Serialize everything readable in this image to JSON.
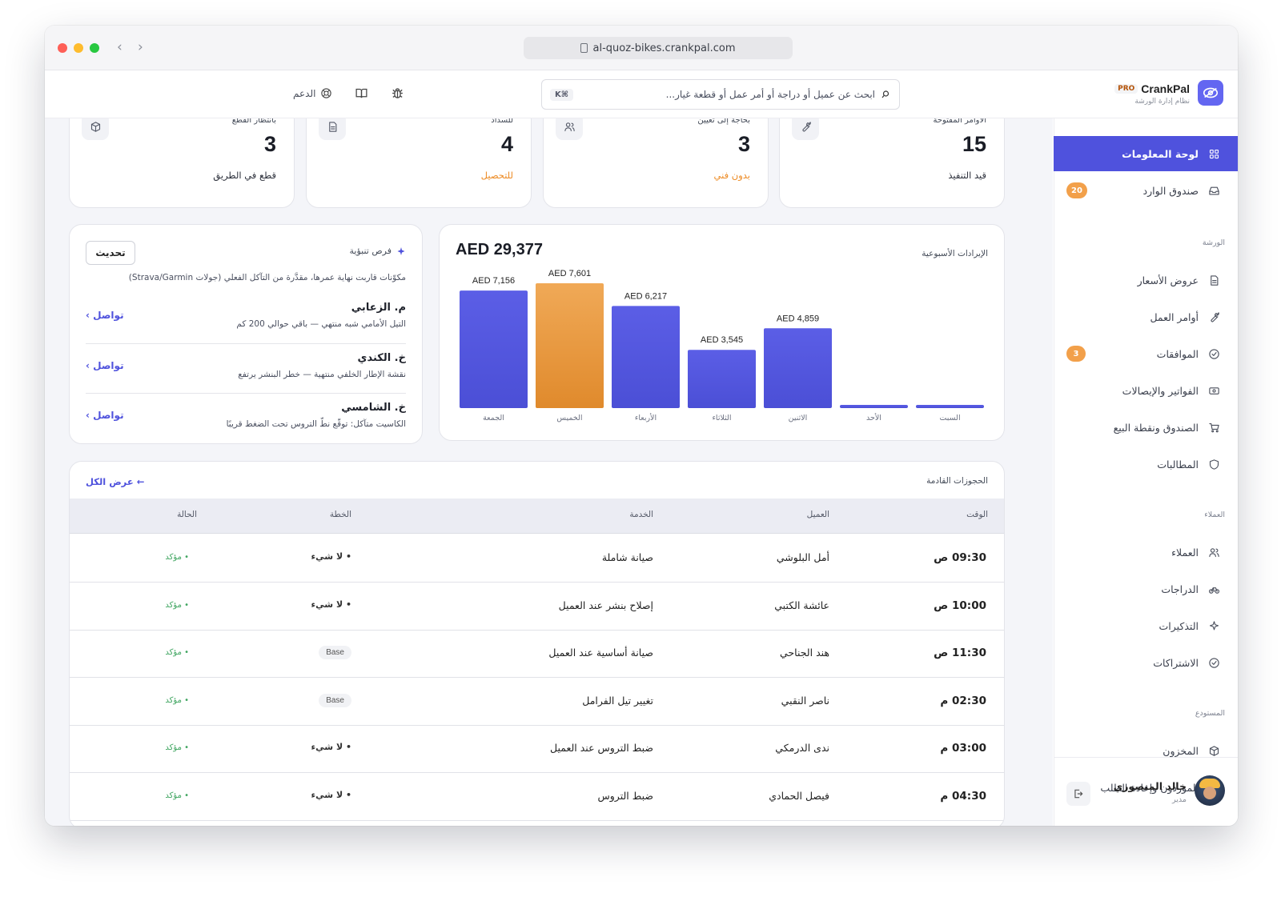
{
  "browser": {
    "url": "al-quoz-bikes.crankpal.com"
  },
  "app": {
    "name": "CrankPal",
    "plan_badge": "PRO",
    "subtitle": "نظام إدارة الورشة"
  },
  "search": {
    "placeholder": "ابحث عن عميل أو دراجة أو أمر عمل أو قطعة غيار...",
    "shortcut": "⌘K"
  },
  "topbar": {
    "support": "الدعم",
    "icons": [
      "bug-icon",
      "book-icon",
      "lifebuoy-icon"
    ]
  },
  "sidebar": {
    "items": [
      {
        "label": "لوحة المعلومات",
        "icon": "dashboard-icon",
        "active": true
      },
      {
        "label": "صندوق الوارد",
        "icon": "inbox-icon",
        "badge": "20"
      }
    ],
    "sections": [
      {
        "title": "الورشة",
        "items": [
          {
            "label": "عروض الأسعار",
            "icon": "quote-icon"
          },
          {
            "label": "أوامر العمل",
            "icon": "wrench-icon"
          },
          {
            "label": "الموافقات",
            "icon": "check-circle-icon",
            "badge": "3"
          },
          {
            "label": "الفواتير والإيصالات",
            "icon": "cash-icon"
          },
          {
            "label": "الصندوق ونقطة البيع",
            "icon": "cart-icon"
          },
          {
            "label": "المطالبات",
            "icon": "shield-icon"
          }
        ]
      },
      {
        "title": "العملاء",
        "items": [
          {
            "label": "العملاء",
            "icon": "users-icon"
          },
          {
            "label": "الدراجات",
            "icon": "bike-icon"
          },
          {
            "label": "التذكيرات",
            "icon": "sparkle-icon"
          },
          {
            "label": "الاشتراكات",
            "icon": "check-circle-icon"
          }
        ]
      },
      {
        "title": "المستودع",
        "items": [
          {
            "label": "المخزون",
            "icon": "box-icon"
          },
          {
            "label": "الموردون وإعادة الطلب",
            "icon": "truck-icon"
          }
        ]
      }
    ],
    "user": {
      "name": "خالد المنصوري",
      "role": "مدير"
    }
  },
  "stats": [
    {
      "label": "الأوامر المفتوحة",
      "value": "15",
      "sub": "قيد التنفيذ",
      "icon": "wrench-icon"
    },
    {
      "label": "بحاجة إلى تعيين",
      "value": "3",
      "sub": "بدون فني",
      "icon": "users-icon"
    },
    {
      "label": "للسداد",
      "value": "4",
      "sub": "للتحصيل",
      "icon": "document-icon"
    },
    {
      "label": "بانتظار القطع",
      "value": "3",
      "sub": "قطع في الطريق",
      "icon": "box-icon"
    }
  ],
  "revenue": {
    "title": "الإيرادات الأسبوعية",
    "total": "AED 29,377"
  },
  "chart_data": {
    "type": "bar",
    "title": "الإيرادات الأسبوعية",
    "categories": [
      "الجمعة",
      "الخميس",
      "الأربعاء",
      "الثلاثاء",
      "الاثنين",
      "الأحد",
      "السبت"
    ],
    "values": [
      7156,
      7601,
      6217,
      3545,
      4859,
      0,
      0
    ],
    "data_labels": [
      "AED 7,156",
      "AED 7,601",
      "AED 6,217",
      "AED 3,545",
      "AED 4,859",
      "",
      ""
    ],
    "highlight_index": 1,
    "colors": {
      "bar": "#5457e0",
      "highlight": "#ec9a3f"
    },
    "grid": false
  },
  "insights": {
    "title": "فرص تنبؤية",
    "refresh": "تحديث",
    "description": "مكوّنات قاربت نهاية عمرها، مقدَّرة من التآكل الفعلي (جولات Strava/Garmin)",
    "items": [
      {
        "name": "م. الزعابي",
        "detail": "التيل الأمامي شبه منتهي — باقي حوالي 200 كم",
        "cta": "تواصل ›"
      },
      {
        "name": "خ. الكندي",
        "detail": "نقشة الإطار الخلفي منتهية — خطر البنشر يرتفع",
        "cta": "تواصل ›"
      },
      {
        "name": "خ. الشامسي",
        "detail": "الكاسيت متآكل: توقّع نطّ التروس تحت الضغط قريبًا",
        "cta": "تواصل ›"
      }
    ]
  },
  "bookings": {
    "title": "الحجوزات القادمة",
    "view_all": "عرض الكل ←",
    "columns": {
      "time": "الوقت",
      "customer": "العميل",
      "service": "الخدمة",
      "plan": "الخطة",
      "status": "الحالة"
    },
    "rows": [
      {
        "time": "09:30 ص",
        "customer": "أمل البلوشي",
        "service": "صيانة شاملة",
        "plan": "• لا شيء",
        "plan_pill": false,
        "status": "• مؤكد"
      },
      {
        "time": "10:00 ص",
        "customer": "عائشة الكتبي",
        "service": "إصلاح بنشر عند العميل",
        "plan": "• لا شيء",
        "plan_pill": false,
        "status": "• مؤكد"
      },
      {
        "time": "11:30 ص",
        "customer": "هند الجناحي",
        "service": "صيانة أساسية عند العميل",
        "plan": "Base",
        "plan_pill": true,
        "status": "• مؤكد"
      },
      {
        "time": "02:30 م",
        "customer": "ناصر النقبي",
        "service": "تغيير تيل الفرامل",
        "plan": "Base",
        "plan_pill": true,
        "status": "• مؤكد"
      },
      {
        "time": "03:00 م",
        "customer": "ندى الدرمكي",
        "service": "ضبط التروس عند العميل",
        "plan": "• لا شيء",
        "plan_pill": false,
        "status": "• مؤكد"
      },
      {
        "time": "04:30 م",
        "customer": "فيصل الحمادي",
        "service": "ضبط التروس",
        "plan": "• لا شيء",
        "plan_pill": false,
        "status": "• مؤكد"
      }
    ]
  }
}
